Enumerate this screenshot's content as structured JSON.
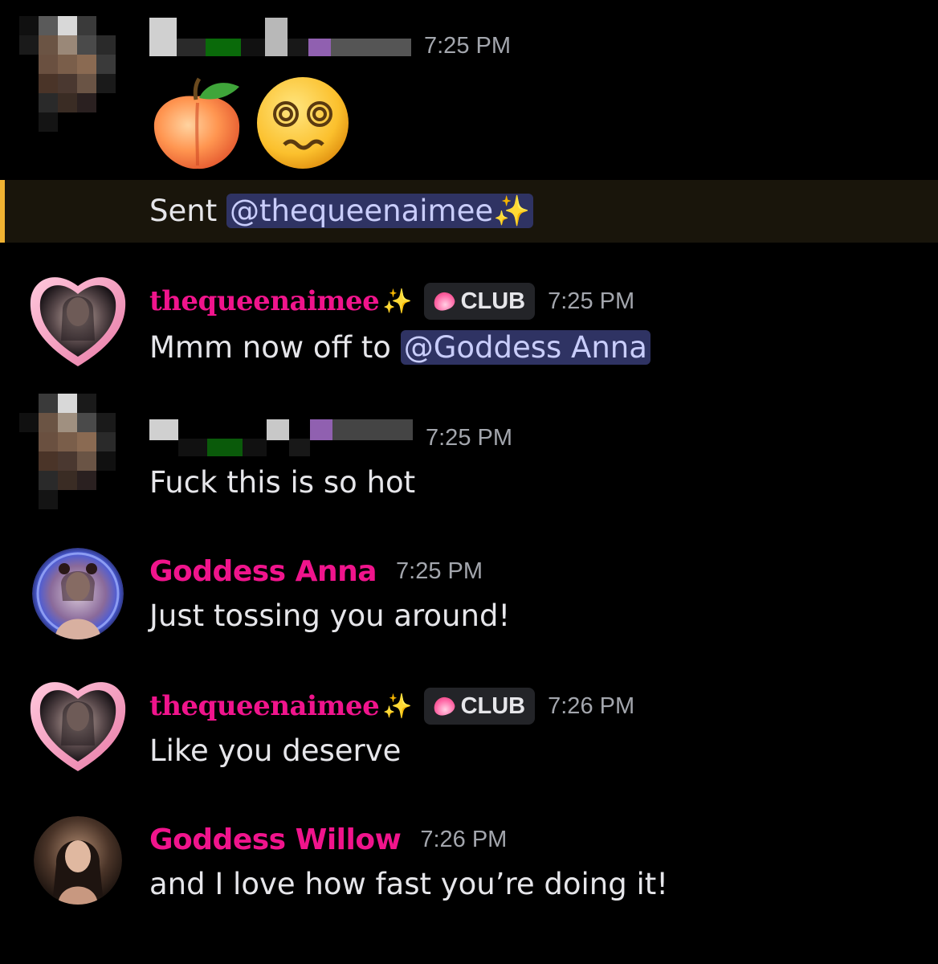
{
  "messages": [
    {
      "id": "m1",
      "username": "",
      "censored": true,
      "time": "7:25 PM",
      "emojis": [
        "peach-emoji",
        "dizzy-face-emoji"
      ]
    },
    {
      "id": "m1b",
      "text_prefix": "Sent ",
      "mention": "@thequeenaimee✨"
    },
    {
      "id": "m2",
      "username": "thequeenaimee",
      "sparkle": "✨",
      "badge": "CLUB",
      "time": "7:25 PM",
      "text_prefix": "Mmm now off to ",
      "mention": "@Goddess Anna"
    },
    {
      "id": "m3",
      "username": "",
      "censored": true,
      "time": "7:25 PM",
      "text": "Fuck this is so hot"
    },
    {
      "id": "m4",
      "username": "Goddess Anna",
      "time": "7:25 PM",
      "text": "Just tossing you around!"
    },
    {
      "id": "m5",
      "username": "thequeenaimee",
      "sparkle": "✨",
      "badge": "CLUB",
      "time": "7:26 PM",
      "text": "Like you deserve"
    },
    {
      "id": "m6",
      "username": "Goddess Willow",
      "time": "7:26 PM",
      "text": "and I love how fast you’re doing it!"
    }
  ],
  "colors": {
    "background": "#000000",
    "username": "#f0148c",
    "mention_bg": "#2f3363",
    "mention_text": "#c9cdfb",
    "highlight_bg": "#19150b",
    "highlight_bar": "#f0b232",
    "timestamp": "#a3a6ad"
  }
}
